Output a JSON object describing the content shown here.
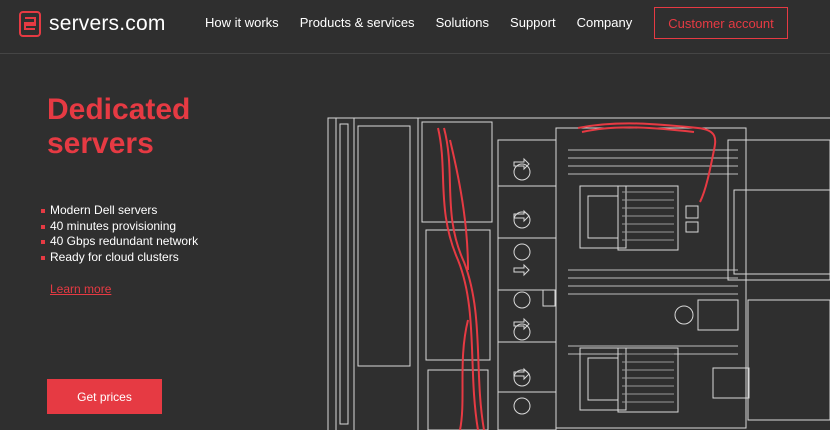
{
  "brand": {
    "name": "servers.com",
    "logo_icon": "servers-logo-icon",
    "accent_color": "#e63a43",
    "background_color": "#2f2f2f"
  },
  "nav": {
    "items": [
      {
        "label": "How it works"
      },
      {
        "label": "Products & services"
      },
      {
        "label": "Solutions"
      },
      {
        "label": "Support"
      },
      {
        "label": "Company"
      }
    ],
    "customer_account": "Customer account"
  },
  "hero": {
    "title_line1": "Dedicated",
    "title_line2": "servers",
    "features": [
      "Modern Dell servers",
      "40 minutes provisioning",
      "40 Gbps redundant network",
      "Ready for cloud clusters"
    ],
    "learn_more": "Learn more",
    "cta": "Get prices"
  },
  "illustration": {
    "icon": "server-motherboard-illustration"
  }
}
